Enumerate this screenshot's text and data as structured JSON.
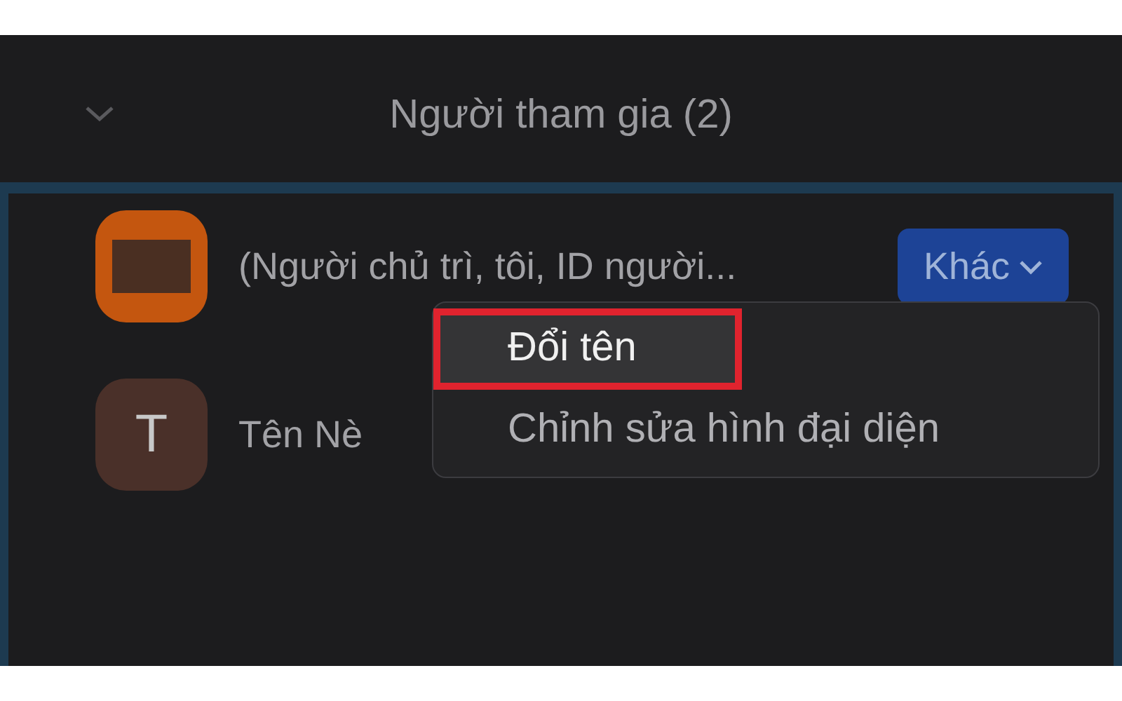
{
  "header": {
    "title": "Người tham gia (2)"
  },
  "participants": [
    {
      "name": "(Người chủ trì, tôi, ID người...",
      "avatar": {
        "kind": "video-off"
      },
      "button": "Khác"
    },
    {
      "name": "Tên Nè",
      "avatar": {
        "kind": "initial",
        "initial": "T"
      }
    }
  ],
  "menu": {
    "items": [
      {
        "label": "Đổi tên",
        "selected": true,
        "outlined": true
      },
      {
        "label": "Chỉnh sửa hình đại diện",
        "selected": false,
        "outlined": false
      }
    ]
  }
}
